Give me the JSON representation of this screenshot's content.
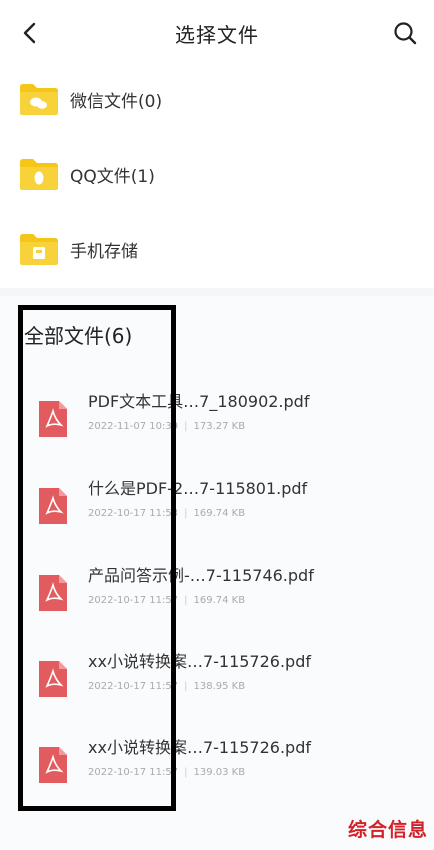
{
  "header": {
    "title": "选择文件"
  },
  "folders": [
    {
      "label": "微信文件(0)",
      "icon": "wechat-folder-icon"
    },
    {
      "label": "QQ文件(1)",
      "icon": "qq-folder-icon"
    },
    {
      "label": "手机存储",
      "icon": "phone-storage-folder-icon"
    }
  ],
  "files_section": {
    "title": "全部文件(6)",
    "files": [
      {
        "name": "PDF文本工具…7_180902.pdf",
        "date": "2022-11-07 10:39",
        "size": "173.27 KB"
      },
      {
        "name": "什么是PDF-2…7-115801.pdf",
        "date": "2022-10-17 11:53",
        "size": "169.74 KB"
      },
      {
        "name": "产品问答示例-…7-115746.pdf",
        "date": "2022-10-17 11:57",
        "size": "169.74 KB"
      },
      {
        "name": "xx小说转换案…7-115726.pdf",
        "date": "2022-10-17 11:57",
        "size": "138.95 KB"
      },
      {
        "name": "xx小说转换案…7-115726.pdf",
        "date": "2022-10-17 11:57",
        "size": "139.03 KB"
      }
    ]
  },
  "meta_separator": "|",
  "watermark": "综合信息",
  "colors": {
    "folder": "#f5c518",
    "pdf": "#e25b5e",
    "annotation_box": "#000000",
    "watermark": "#d2232a"
  }
}
